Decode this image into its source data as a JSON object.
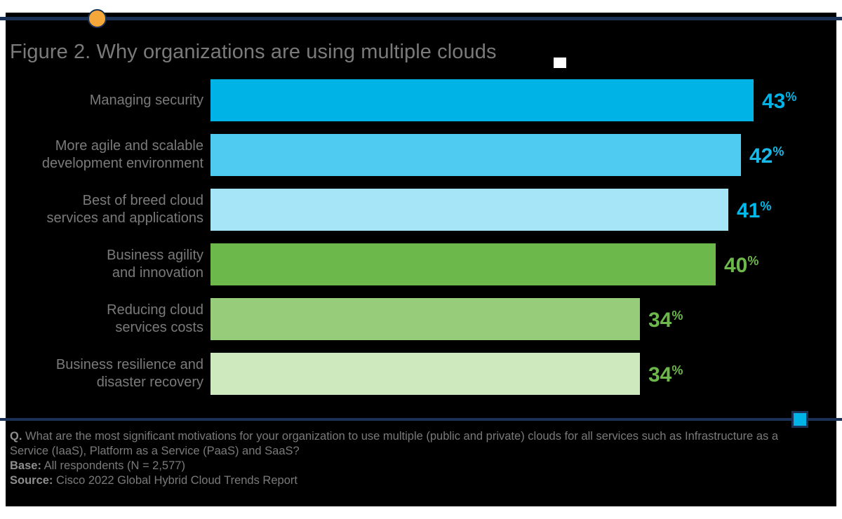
{
  "figure": {
    "title": "Figure 2. Why organizations are using multiple clouds",
    "background": "#000000",
    "rule_color": "#1b3156",
    "dot_color": "#f5a839",
    "label_color": "#7a7a7a"
  },
  "chart_data": {
    "type": "bar",
    "orientation": "horizontal",
    "title": "Figure 2. Why organizations are using multiple clouds",
    "xlabel": "",
    "ylabel": "",
    "xlim": [
      0,
      47
    ],
    "grid": false,
    "legend": "none",
    "value_suffix": "%",
    "categories": [
      "Managing security",
      "More agile and scalable\ndevelopment environment",
      "Best of breed cloud\nservices and applications",
      "Business agility\nand innovation",
      "Reducing cloud\nservices costs",
      "Business resilience and\ndisaster recovery"
    ],
    "values": [
      43,
      42,
      41,
      40,
      34,
      34
    ],
    "value_labels": [
      "43",
      "42",
      "41",
      "40",
      "34",
      "34"
    ],
    "bar_colors": [
      "#00b3e6",
      "#4fcbf2",
      "#a6e4f7",
      "#6cb84a",
      "#97cd7a",
      "#cde9bd"
    ],
    "label_colors": [
      "#00b3e6",
      "#1ab9e8",
      "#00b9ec",
      "#6cb84a",
      "#6cb84a",
      "#6cb84a"
    ]
  },
  "footnotes": {
    "q_label": "Q.",
    "q_text": "What are the most significant motivations for your organization to use multiple (public and private) clouds for all services such as Infrastructure as a Service (IaaS), Platform as a Service (PaaS) and SaaS?",
    "base_label": "Base:",
    "base_text": "All respondents (N = 2,577)",
    "source_label": "Source:",
    "source_text": "Cisco 2022 Global Hybrid Cloud Trends Report"
  }
}
